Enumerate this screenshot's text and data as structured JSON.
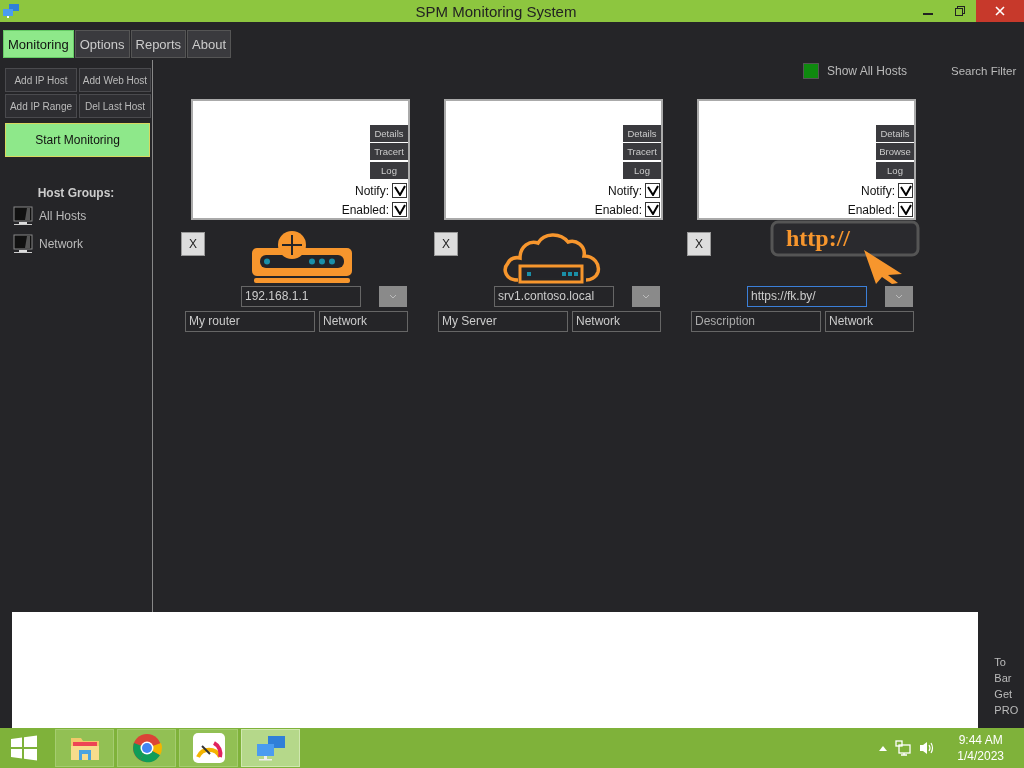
{
  "window": {
    "title": "SPM Monitoring System"
  },
  "tabs": [
    {
      "label": "Monitoring",
      "selected": true
    },
    {
      "label": "Options",
      "selected": false
    },
    {
      "label": "Reports",
      "selected": false
    },
    {
      "label": "About",
      "selected": false
    }
  ],
  "sidebar": {
    "actions": [
      "Add IP Host",
      "Add Web Host",
      "Add IP Range",
      "Del Last Host"
    ],
    "start_button": "Start Monitoring",
    "groups_heading": "Host Groups:",
    "groups": [
      "All Hosts",
      "Network"
    ]
  },
  "toolbar": {
    "show_all_hosts": {
      "label": "Show All Hosts",
      "checked": true
    },
    "search_label": "Search Filter"
  },
  "hosts": [
    {
      "kind": "router",
      "buttons": [
        "Details",
        "Tracert",
        "Log"
      ],
      "notify_label": "Notify:",
      "notify": true,
      "enabled_label": "Enabled:",
      "enabled": true,
      "remove": "X",
      "address": "192.168.1.1",
      "focused": false,
      "description": "My router",
      "group": "Network"
    },
    {
      "kind": "server",
      "buttons": [
        "Details",
        "Tracert",
        "Log"
      ],
      "notify_label": "Notify:",
      "notify": true,
      "enabled_label": "Enabled:",
      "enabled": true,
      "remove": "X",
      "address": "srv1.contoso.local",
      "focused": false,
      "description": "My Server",
      "group": "Network"
    },
    {
      "kind": "web",
      "icon_text": "http://",
      "buttons": [
        "Details",
        "Browse",
        "Log"
      ],
      "notify_label": "Notify:",
      "notify": true,
      "enabled_label": "Enabled:",
      "enabled": true,
      "remove": "X",
      "address": "https://fk.by/",
      "focused": true,
      "description_placeholder": "Description",
      "group": "Network"
    }
  ],
  "side_note_lines": [
    "To",
    "Bar",
    "Get",
    "PRO"
  ],
  "taskbar": {
    "apps": [
      {
        "kind": "folder",
        "selected": false
      },
      {
        "kind": "browser",
        "selected": false
      },
      {
        "kind": "gauge",
        "selected": false
      },
      {
        "kind": "network",
        "selected": true
      }
    ],
    "time": "9:44 AM",
    "date": "1/4/2023"
  }
}
